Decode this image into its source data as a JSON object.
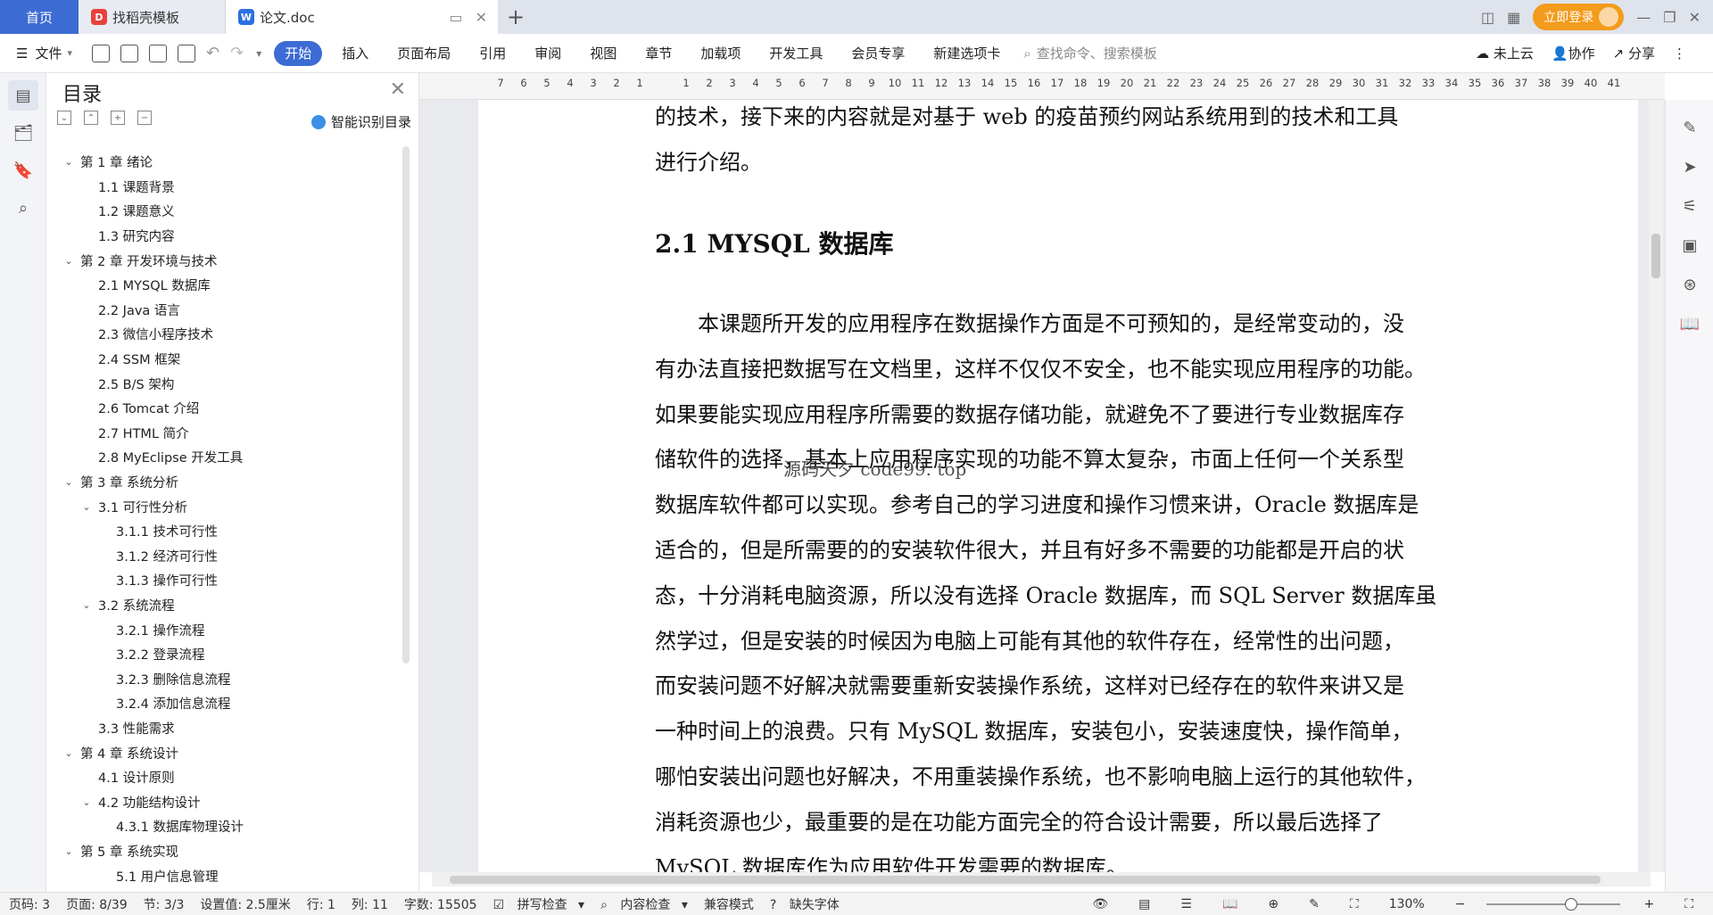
{
  "tabs": {
    "home": "首页",
    "template": "找稻壳模板",
    "document": "论文.doc",
    "new_tab": "+"
  },
  "window": {
    "login": "立即登录"
  },
  "menubar": {
    "file": "文件",
    "items": [
      "开始",
      "插入",
      "页面布局",
      "引用",
      "审阅",
      "视图",
      "章节",
      "加载项",
      "开发工具",
      "会员专享",
      "新建选项卡"
    ],
    "search_placeholder": "查找命令、搜索模板",
    "cloud": "未上云",
    "collab": "协作",
    "share": "分享"
  },
  "toc": {
    "title": "目录",
    "smart": "智能识别目录",
    "items": [
      {
        "label": "第 1 章  绪论",
        "level": 1,
        "chev": "v"
      },
      {
        "label": "1.1  课题背景",
        "level": 2,
        "chev": ""
      },
      {
        "label": "1.2  课题意义",
        "level": 2,
        "chev": ""
      },
      {
        "label": "1.3  研究内容",
        "level": 2,
        "chev": ""
      },
      {
        "label": "第 2 章  开发环境与技术",
        "level": 1,
        "chev": "v"
      },
      {
        "label": "2.1 MYSQL 数据库",
        "level": 2,
        "chev": ""
      },
      {
        "label": "2.2 Java 语言",
        "level": 2,
        "chev": ""
      },
      {
        "label": "2.3  微信小程序技术",
        "level": 2,
        "chev": ""
      },
      {
        "label": "2.4 SSM 框架",
        "level": 2,
        "chev": ""
      },
      {
        "label": "2.5 B/S 架构",
        "level": 2,
        "chev": ""
      },
      {
        "label": "2.6 Tomcat  介绍",
        "level": 2,
        "chev": ""
      },
      {
        "label": "2.7 HTML 简介",
        "level": 2,
        "chev": ""
      },
      {
        "label": "2.8 MyEclipse 开发工具",
        "level": 2,
        "chev": ""
      },
      {
        "label": "第 3 章  系统分析",
        "level": 1,
        "chev": "v"
      },
      {
        "label": "3.1  可行性分析",
        "level": 2,
        "chev": "v"
      },
      {
        "label": "3.1.1  技术可行性",
        "level": 3,
        "chev": ""
      },
      {
        "label": "3.1.2  经济可行性",
        "level": 3,
        "chev": ""
      },
      {
        "label": "3.1.3  操作可行性",
        "level": 3,
        "chev": ""
      },
      {
        "label": "3.2  系统流程",
        "level": 2,
        "chev": "v"
      },
      {
        "label": "3.2.1  操作流程",
        "level": 3,
        "chev": ""
      },
      {
        "label": "3.2.2  登录流程",
        "level": 3,
        "chev": ""
      },
      {
        "label": "3.2.3  删除信息流程",
        "level": 3,
        "chev": ""
      },
      {
        "label": "3.2.4  添加信息流程",
        "level": 3,
        "chev": ""
      },
      {
        "label": "3.3  性能需求",
        "level": 2,
        "chev": ""
      },
      {
        "label": "第 4 章  系统设计",
        "level": 1,
        "chev": "v"
      },
      {
        "label": "4.1  设计原则",
        "level": 2,
        "chev": ""
      },
      {
        "label": "4.2  功能结构设计",
        "level": 2,
        "chev": "v"
      },
      {
        "label": "4.3.1  数据库物理设计",
        "level": 3,
        "chev": ""
      },
      {
        "label": "第 5 章  系统实现",
        "level": 1,
        "chev": "v"
      },
      {
        "label": "5.1 用户信息管理",
        "level": 3,
        "chev": ""
      }
    ]
  },
  "ruler": {
    "numbers": [
      "7",
      "6",
      "5",
      "4",
      "3",
      "2",
      "1",
      "",
      "1",
      "2",
      "3",
      "4",
      "5",
      "6",
      "7",
      "8",
      "9",
      "10",
      "11",
      "12",
      "13",
      "14",
      "15",
      "16",
      "17",
      "18",
      "19",
      "20",
      "21",
      "22",
      "23",
      "24",
      "25",
      "26",
      "27",
      "28",
      "29",
      "30",
      "31",
      "32",
      "33",
      "34",
      "35",
      "36",
      "37",
      "38",
      "39",
      "40",
      "41"
    ]
  },
  "document": {
    "para_top_1": "的技术，接下来的内容就是对基于 web 的疫苗预约网站系统用到的技术和工具",
    "para_top_2": "进行介绍。",
    "heading": "2.1 MYSQL 数据库",
    "lines": [
      "　　本课题所开发的应用程序在数据操作方面是不可预知的，是经常变动的，没",
      "有办法直接把数据写在文档里，这样不仅仅不安全，也不能实现应用程序的功能。",
      "如果要能实现应用程序所需要的数据存储功能，就避免不了要进行专业数据库存",
      "储软件的选择，基本上应用程序实现的功能不算太复杂，市面上任何一个关系型",
      "数据库软件都可以实现。参考自己的学习进度和操作习惯来讲，Oracle 数据库是",
      "适合的，但是所需要的的安装软件很大，并且有好多不需要的功能都是开启的状",
      "态，十分消耗电脑资源，所以没有选择 Oracle 数据库，而 SQL Server 数据库虽",
      "然学过，但是安装的时候因为电脑上可能有其他的软件存在，经常性的出问题，",
      "而安装问题不好解决就需要重新安装操作系统，这样对已经存在的软件来讲又是",
      "一种时间上的浪费。只有 MySQL 数据库，安装包小，安装速度快，操作简单，",
      "哪怕安装出问题也好解决，不用重装操作系统，也不影响电脑上运行的其他软件，",
      "消耗资源也少，最重要的是在功能方面完全的符合设计需要，所以最后选择了",
      "MySQL 数据库作为应用软件开发需要的数据库。"
    ],
    "watermark": "源码天夕 code99. top"
  },
  "status": {
    "page_no": "页码: 3",
    "page": "页面: 8/39",
    "section": "节: 3/3",
    "setting": "设置值: 2.5厘米",
    "row": "行: 1",
    "col": "列: 11",
    "words": "字数: 15505",
    "spell": "拼写检查",
    "content_check": "内容检查",
    "compat": "兼容模式",
    "missing_font": "缺失字体",
    "zoom": "130%"
  }
}
